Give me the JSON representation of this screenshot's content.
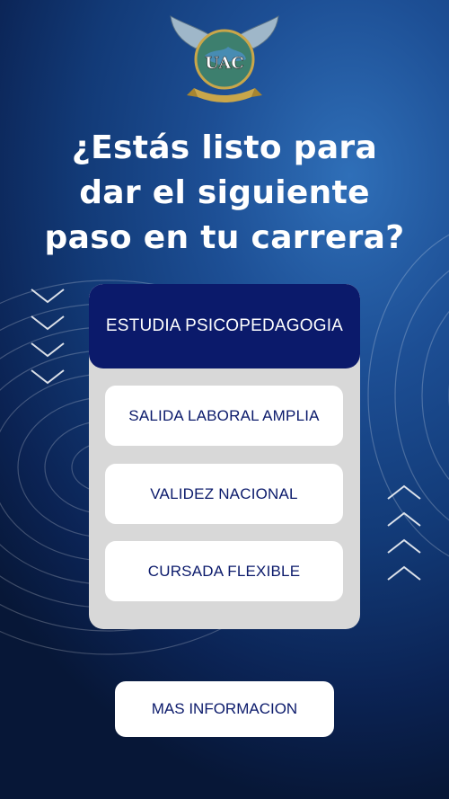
{
  "logo": {
    "text": "UAC",
    "icon": "uac-winged-globe-emblem"
  },
  "headline": {
    "lines": [
      "¿Estás listo para",
      "dar el siguiente",
      "paso en tu carrera?"
    ]
  },
  "card": {
    "header": "ESTUDIA PSICOPEDAGOGIA",
    "features": [
      "SALIDA LABORAL AMPLIA",
      "VALIDEZ NACIONAL",
      "CURSADA FLEXIBLE"
    ]
  },
  "cta": {
    "label": "MAS INFORMACION"
  },
  "decor": {
    "left_icon": "chevron-down-icon",
    "right_icon": "chevron-up-icon"
  },
  "colors": {
    "navy": "#0b1a6b",
    "card_bg": "#d8d8d8",
    "background": "#123a77",
    "white": "#ffffff"
  }
}
